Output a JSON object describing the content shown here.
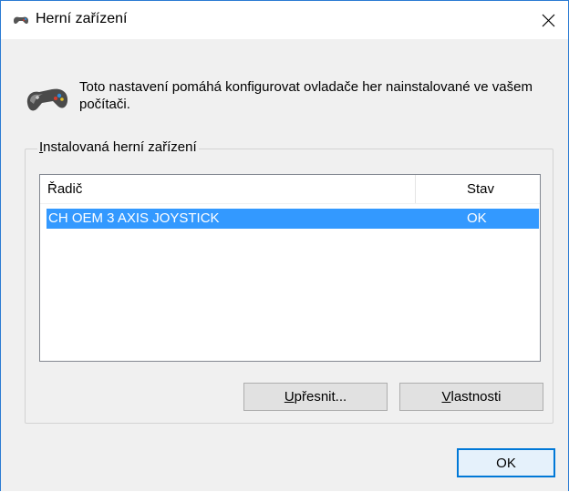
{
  "window": {
    "title": "Herní zařízení",
    "close_label": "×"
  },
  "intro": {
    "text": "Toto nastavení pomáhá konfigurovat ovladače her nainstalované ve vašem počítači."
  },
  "group": {
    "label_first": "I",
    "label_rest": "nstalovaná herní zařízení"
  },
  "table": {
    "columns": [
      "Řadič",
      "Stav"
    ],
    "rows": [
      {
        "name": "CH OEM 3 AXIS JOYSTICK",
        "status": "OK",
        "selected": true
      }
    ]
  },
  "buttons": {
    "advanced_first": "U",
    "advanced_rest": "přesnit...",
    "properties_first": "V",
    "properties_rest": "lastnosti",
    "ok": "OK"
  },
  "colors": {
    "selection": "#3399ff",
    "window_border": "#2b7bd3",
    "default_button_border": "#0078d7"
  },
  "icons": {
    "title": "gamepad-icon",
    "header": "gamepad-icon",
    "close": "close-icon"
  }
}
